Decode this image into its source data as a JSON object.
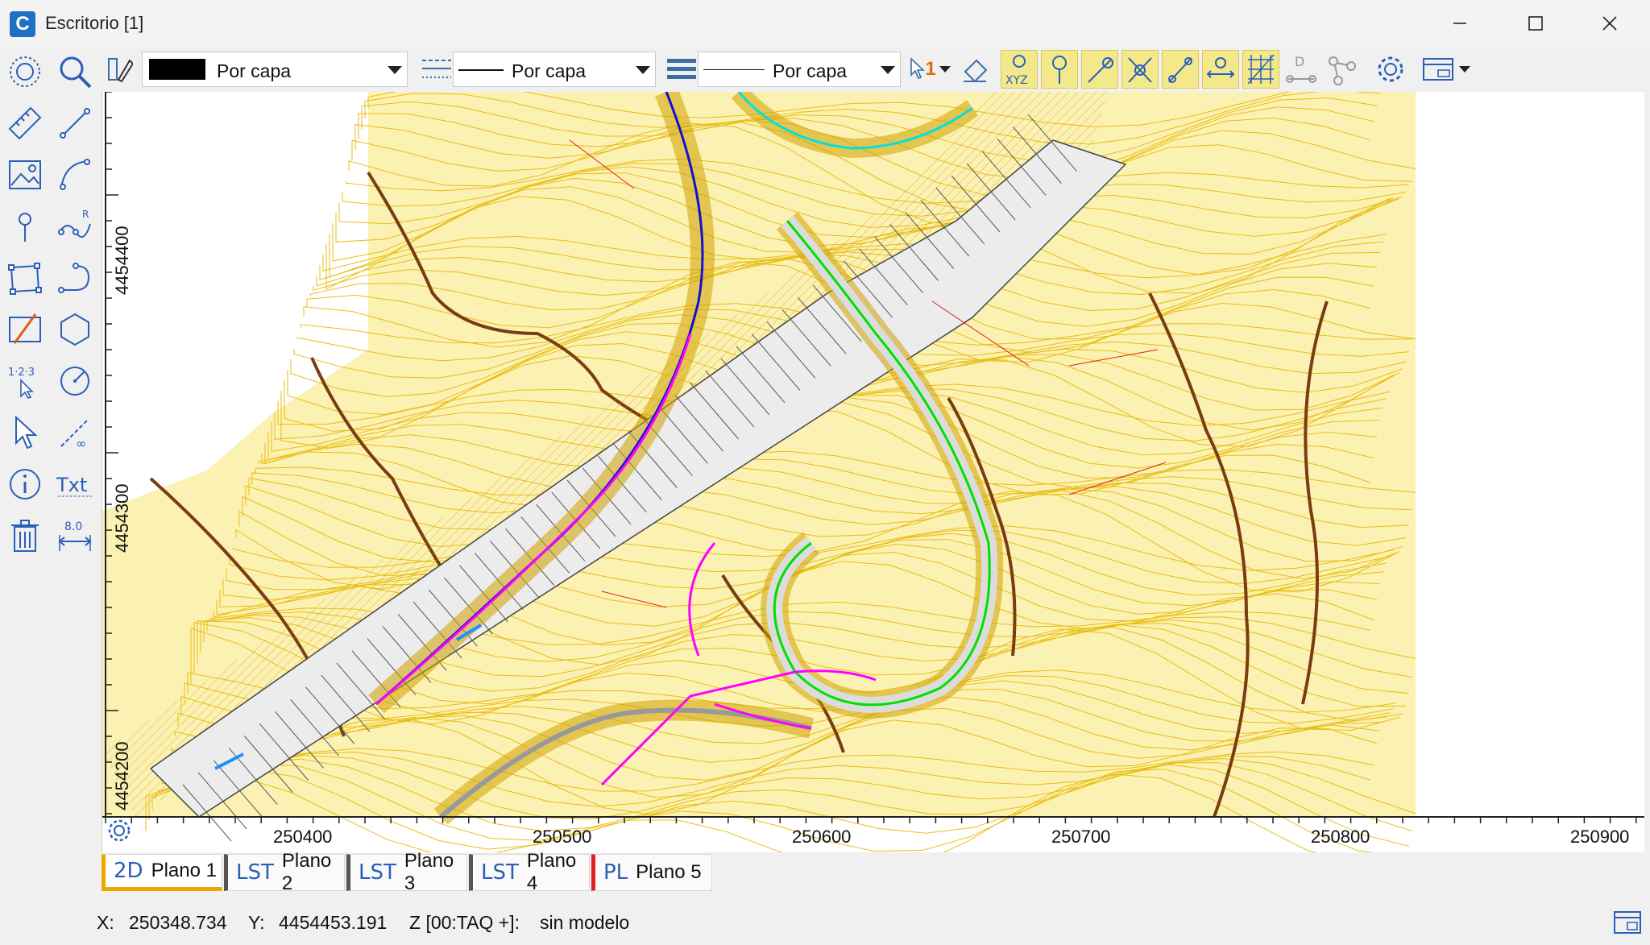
{
  "window": {
    "title": "Escritorio [1]",
    "app_icon_letter": "C"
  },
  "toolbar": {
    "color_combo": {
      "label": "Por capa",
      "swatch": "#000000"
    },
    "linetype_combo": {
      "label": "Por capa"
    },
    "lineweight_combo": {
      "label": "Por capa"
    },
    "selection_count": "1",
    "xyz_label": "XYZ",
    "d_label": "D"
  },
  "left_toolbar": {
    "numbering_label": "1·2·3",
    "txt_label": "Txt",
    "dim_label": "8.0",
    "r_label": "R"
  },
  "map": {
    "y_axis_labels": [
      "4454400",
      "4454300",
      "4454200"
    ],
    "x_axis_labels": [
      "250400",
      "250500",
      "250600",
      "250700",
      "250800",
      "250900"
    ],
    "background": "#fbf3b0",
    "contour_color": "#e8b800",
    "road_colors": {
      "blue": "#1010d0",
      "magenta": "#ff00ff",
      "green": "#00e000",
      "cyan": "#00e0e0",
      "brown": "#6b3410"
    }
  },
  "tabs": [
    {
      "prefix": "2D",
      "label": "Plano 1",
      "active": true,
      "accent": "#f0a800"
    },
    {
      "prefix": "LST",
      "label": "Plano 2",
      "active": false,
      "accent": "#555555"
    },
    {
      "prefix": "LST",
      "label": "Plano 3",
      "active": false,
      "accent": "#555555"
    },
    {
      "prefix": "LST",
      "label": "Plano 4",
      "active": false,
      "accent": "#555555"
    },
    {
      "prefix": "PL",
      "label": "Plano 5",
      "active": false,
      "accent": "#e02020"
    }
  ],
  "status": {
    "x_label": "X:",
    "x_value": "250348.734",
    "y_label": "Y:",
    "y_value": "4454453.191",
    "z_label": "Z [00:TAQ +]:",
    "z_value": "sin modelo"
  }
}
